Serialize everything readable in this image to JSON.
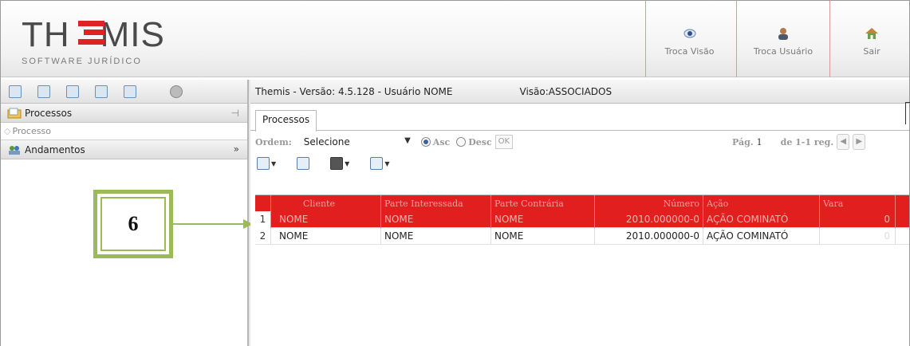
{
  "header": {
    "logo_title": "TH",
    "logo_title_end": "MIS",
    "logo_subtitle": "SOFTWARE JURÍDICO",
    "buttons": [
      {
        "label": "Troca Visão",
        "icon": "eye-icon"
      },
      {
        "label": "Troca Usuário",
        "icon": "user-icon"
      },
      {
        "label": "Sair",
        "icon": "home-icon"
      }
    ]
  },
  "sidebar": {
    "sections": [
      {
        "label": "Processos",
        "icon": "folder-icon",
        "pin": "⊣"
      },
      {
        "label": "Andamentos",
        "icon": "people-icon",
        "chevron": "»"
      }
    ],
    "sub_item": "Processo"
  },
  "callout": {
    "number": "6"
  },
  "main": {
    "version_text": "Themis - Versão: 4.5.128 - Usuário NOME",
    "visao_text": "Visão:ASSOCIADOS",
    "tab_label": "Processos",
    "filter": {
      "ordem_label": "Ordem:",
      "select_value": "Selecione",
      "asc_label": "Asc",
      "desc_label": "Desc",
      "ok_label": "OK",
      "pag_label": "Pág.",
      "pag_value": "1",
      "pag_range": "de 1-1 reg."
    },
    "grid": {
      "columns": [
        "Cliente",
        "Parte Interessada",
        "Parte Contrária",
        "Número",
        "Ação",
        "Vara"
      ],
      "rows": [
        {
          "n": "1",
          "cliente": "NOME",
          "parte_interessada": "NOME",
          "parte_contraria": "NOME",
          "numero": "2010.000000-0",
          "acao": "AÇÃO COMINATÓ",
          "vara": "0"
        },
        {
          "n": "2",
          "cliente": "NOME",
          "parte_interessada": "NOME",
          "parte_contraria": "NOME",
          "numero": "2010.000000-0",
          "acao": "AÇÃO COMINATÓ",
          "vara": "0"
        }
      ]
    }
  }
}
